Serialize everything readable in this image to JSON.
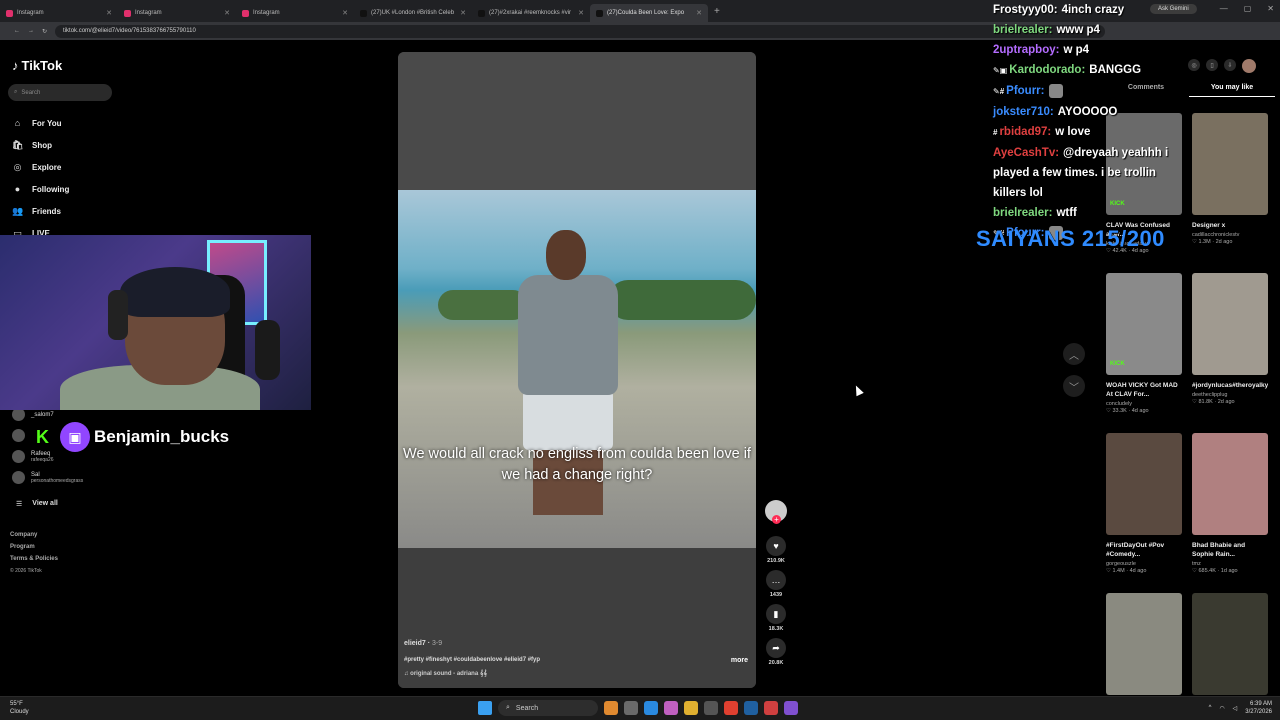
{
  "browser": {
    "tabs": [
      {
        "label": "Instagram",
        "color": "#e1306c",
        "active": false
      },
      {
        "label": "Instagram",
        "color": "#e1306c",
        "active": false
      },
      {
        "label": "Instagram",
        "color": "#e1306c",
        "active": false
      },
      {
        "label": "(27)UK #London #British Celeb",
        "color": "#111111",
        "active": false
      },
      {
        "label": "(27)#2xrakai #reemknocks #vir",
        "color": "#111111",
        "active": false
      },
      {
        "label": "(27)Coulda Been Love: Expo",
        "color": "#111111",
        "active": true
      }
    ],
    "url": "tiktok.com/@elieid7/video/7615383766755790110",
    "ask_gemini": "Ask Gemini"
  },
  "tiktok": {
    "logo": "TikTok",
    "search_placeholder": "Search",
    "nav": [
      {
        "label": "For You",
        "icon": "⌂"
      },
      {
        "label": "Shop",
        "icon": "🛍"
      },
      {
        "label": "Explore",
        "icon": "◎"
      },
      {
        "label": "Following",
        "icon": "●"
      },
      {
        "label": "Friends",
        "icon": "👥"
      },
      {
        "label": "LIVE",
        "icon": "▭"
      }
    ],
    "following": [
      {
        "name": "_salom7",
        "sub": ""
      },
      {
        "name": "",
        "sub": ""
      },
      {
        "name": "Rafeeq",
        "sub": "rafeeqa26"
      },
      {
        "name": "Sal",
        "sub": "personathomeedsgrass"
      }
    ],
    "view_all": "View all",
    "footer": [
      "Company",
      "Program",
      "Terms & Policies"
    ],
    "copyright": "© 2026 TikTok"
  },
  "streamer": {
    "name": "Benjamin_bucks"
  },
  "video": {
    "caption": "We would all crack no engliss from coulda been love if we had a change right?",
    "author": "elieid7",
    "date": "3-9",
    "tags": "#pretty #fineshyt #couldabeenlove #elieid7 #fyp",
    "sound": "original sound - adriana 𝄞𝄞",
    "more": "more",
    "likes": "210.9K",
    "comments": "1439",
    "saves": "18.3K",
    "shares": "20.8K"
  },
  "chat": [
    {
      "user": "Frostyyy00:",
      "color": "#ffffff",
      "badges": "",
      "msg": "4inch crazy"
    },
    {
      "user": "brielrealer:",
      "color": "#7fd87f",
      "badges": "",
      "msg": "www p4"
    },
    {
      "user": "2uptrapboy:",
      "color": "#b46cff",
      "badges": "",
      "msg": "w p4"
    },
    {
      "user": "Kardodorado:",
      "color": "#7fd87f",
      "badges": "✎▣",
      "msg": "BANGGG"
    },
    {
      "user": "Pfourr:",
      "color": "#3a8cff",
      "badges": "✎#",
      "msg": ""
    },
    {
      "user": "jokster710:",
      "color": "#3a8cff",
      "badges": "",
      "msg": "AYOOOOO"
    },
    {
      "user": "rbidad97:",
      "color": "#e04040",
      "badges": "#",
      "msg": "w love"
    },
    {
      "user": "AyeCashTv:",
      "color": "#e04040",
      "badges": "",
      "msg": "@dreyaah yeahhh i played a few times. i be trollin killers lol"
    },
    {
      "user": "brielrealer:",
      "color": "#7fd87f",
      "badges": "",
      "msg": "wtff"
    },
    {
      "user": "Pfourr:",
      "color": "#3a8cff",
      "badges": "✎#",
      "msg": ""
    }
  ],
  "sub_goal": "SAIYANS 215/200",
  "right_panel": {
    "tabs": [
      "Comments",
      "You may like"
    ],
    "active_tab": "You may like",
    "cards": [
      {
        "title": "CLAV Was Confused after...",
        "author": "kickclipsclavdaily",
        "likes": "42.4K",
        "age": "4d ago",
        "bg": "#6a6a6a",
        "kick": "KICK"
      },
      {
        "title": "Designer x",
        "author": "cadillacchroniclestv",
        "likes": "1.3M",
        "age": "2d ago",
        "bg": "#7a7060",
        "kick": ""
      },
      {
        "title": "WOAH VICKY Got MAD At CLAV For...",
        "author": "concludely",
        "likes": "33.3K",
        "age": "4d ago",
        "bg": "#8a8a8a",
        "kick": "KICK"
      },
      {
        "title": "#jordynlucas#theroyalkylesister#fyp...",
        "author": "deetheclipplug",
        "likes": "81.8K",
        "age": "2d ago",
        "bg": "#a09a90",
        "kick": ""
      },
      {
        "title": "#FirstDayOut #Pov #Comedy...",
        "author": "gorgeouszle",
        "likes": "1.4M",
        "age": "4d ago",
        "bg": "#5a4a40",
        "kick": ""
      },
      {
        "title": "Bhad Bhabie and Sophie Rain...",
        "author": "tmz",
        "likes": "685.4K",
        "age": "1d ago",
        "bg": "#b08080",
        "kick": ""
      },
      {
        "title": "",
        "author": "",
        "likes": "",
        "age": "",
        "bg": "#8a8a80",
        "kick": ""
      },
      {
        "title": "",
        "author": "",
        "likes": "",
        "age": "",
        "bg": "#3a3a30",
        "kick": ""
      }
    ]
  },
  "taskbar": {
    "temp": "55°F",
    "weather": "Cloudy",
    "search": "Search",
    "time": "6:39 AM",
    "date": "3/27/2026"
  }
}
